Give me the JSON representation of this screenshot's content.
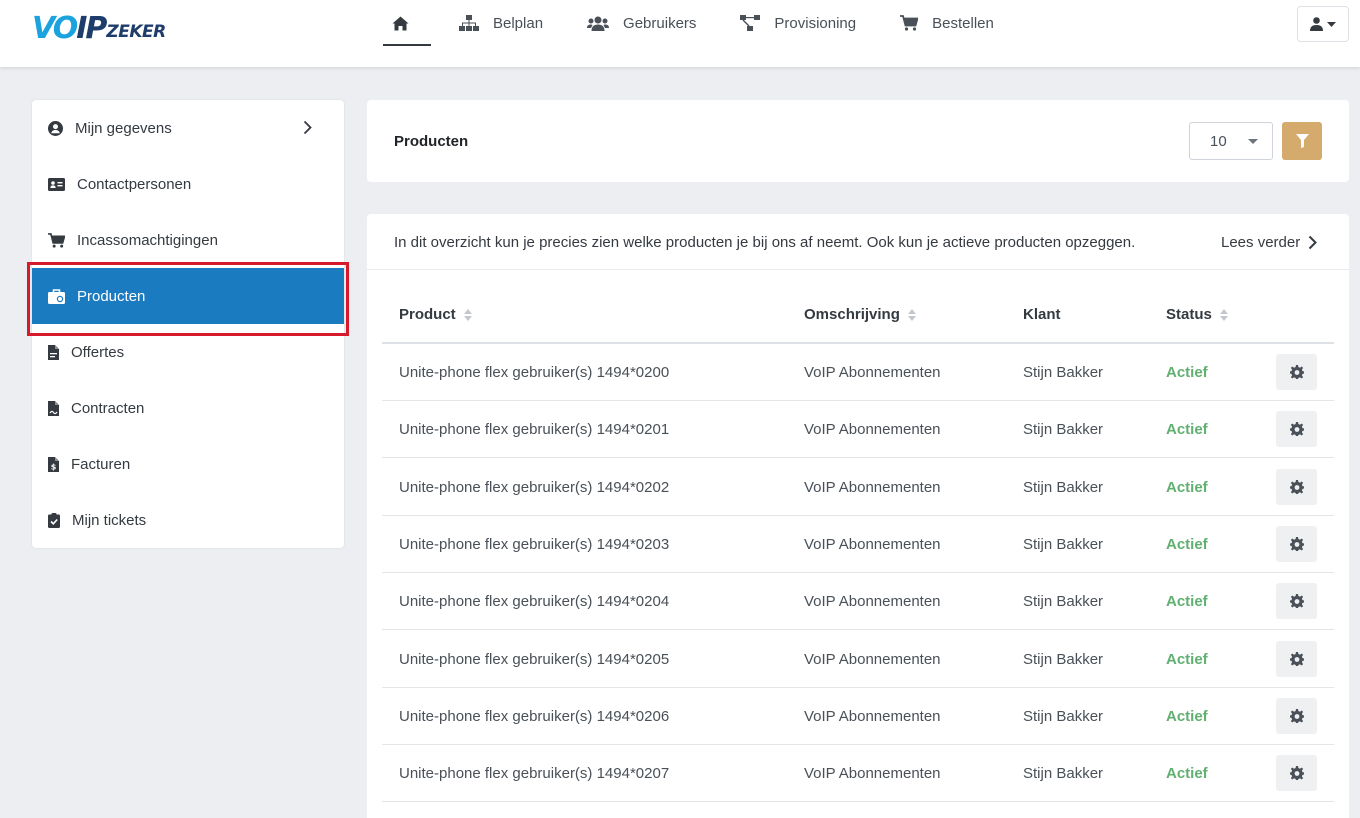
{
  "brand": {
    "logo_voip": "VOIP",
    "logo_zeker": "ZEKER"
  },
  "nav": {
    "home_icon": "home-icon",
    "items": [
      {
        "label": "Belplan",
        "icon": "sitemap-icon"
      },
      {
        "label": "Gebruikers",
        "icon": "users-icon"
      },
      {
        "label": "Provisioning",
        "icon": "project-diagram-icon"
      },
      {
        "label": "Bestellen",
        "icon": "cart-icon"
      }
    ],
    "user_menu_icon": "user-icon"
  },
  "sidebar": {
    "items": [
      {
        "label": "Mijn gegevens",
        "icon": "user-circle-icon"
      },
      {
        "label": "Contactpersonen",
        "icon": "id-card-icon"
      },
      {
        "label": "Incassomachtigingen",
        "icon": "cart-icon"
      },
      {
        "label": "Producten",
        "icon": "briefcase-icon",
        "active": true
      },
      {
        "label": "Offertes",
        "icon": "file-icon"
      },
      {
        "label": "Contracten",
        "icon": "file-contract-icon"
      },
      {
        "label": "Facturen",
        "icon": "invoice-icon"
      },
      {
        "label": "Mijn tickets",
        "icon": "clipboard-check-icon"
      }
    ]
  },
  "header": {
    "title": "Producten",
    "per_page": "10"
  },
  "list": {
    "intro": "In dit overzicht kun je precies zien welke producten je bij ons af neemt. Ook kun je actieve producten opzeggen.",
    "read_more": "Lees verder",
    "columns": {
      "product": "Product",
      "omschrijving": "Omschrijving",
      "klant": "Klant",
      "status": "Status"
    },
    "rows": [
      {
        "product": "Unite-phone flex gebruiker(s) 1494*0200",
        "omschrijving": "VoIP Abonnementen",
        "klant": "Stijn Bakker",
        "status": "Actief"
      },
      {
        "product": "Unite-phone flex gebruiker(s) 1494*0201",
        "omschrijving": "VoIP Abonnementen",
        "klant": "Stijn Bakker",
        "status": "Actief"
      },
      {
        "product": "Unite-phone flex gebruiker(s) 1494*0202",
        "omschrijving": "VoIP Abonnementen",
        "klant": "Stijn Bakker",
        "status": "Actief"
      },
      {
        "product": "Unite-phone flex gebruiker(s) 1494*0203",
        "omschrijving": "VoIP Abonnementen",
        "klant": "Stijn Bakker",
        "status": "Actief"
      },
      {
        "product": "Unite-phone flex gebruiker(s) 1494*0204",
        "omschrijving": "VoIP Abonnementen",
        "klant": "Stijn Bakker",
        "status": "Actief"
      },
      {
        "product": "Unite-phone flex gebruiker(s) 1494*0205",
        "omschrijving": "VoIP Abonnementen",
        "klant": "Stijn Bakker",
        "status": "Actief"
      },
      {
        "product": "Unite-phone flex gebruiker(s) 1494*0206",
        "omschrijving": "VoIP Abonnementen",
        "klant": "Stijn Bakker",
        "status": "Actief"
      },
      {
        "product": "Unite-phone flex gebruiker(s) 1494*0207",
        "omschrijving": "VoIP Abonnementen",
        "klant": "Stijn Bakker",
        "status": "Actief"
      }
    ]
  },
  "colors": {
    "active_nav": "#1a7bc1",
    "status_active": "#61b071",
    "filter_button": "#d5aa6d",
    "highlight": "#d7192c"
  }
}
